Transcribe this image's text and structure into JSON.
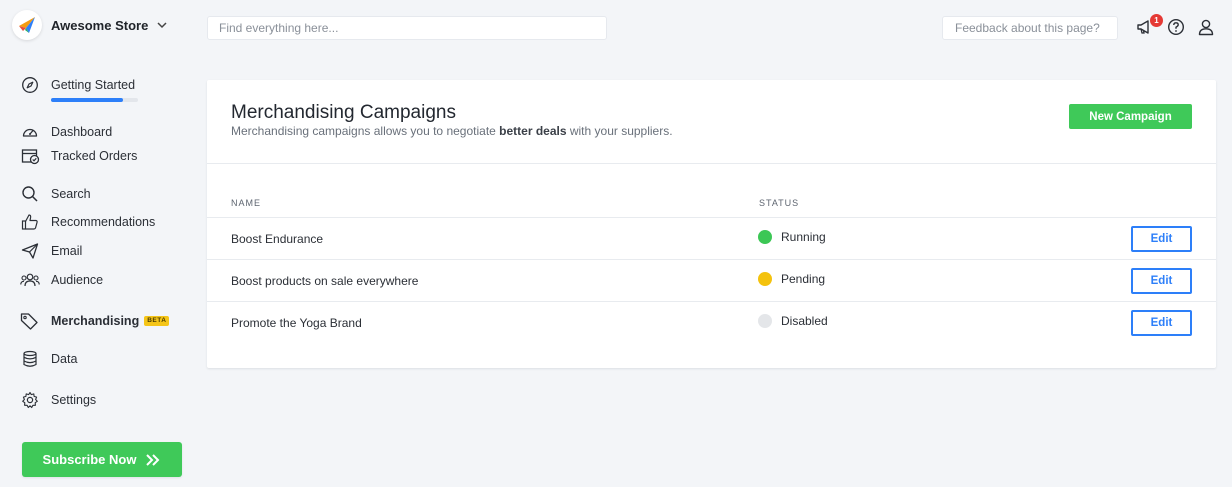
{
  "header": {
    "store_name": "Awesome Store",
    "search_placeholder": "Find everything here...",
    "feedback_placeholder": "Feedback about this page?",
    "notification_count": "1"
  },
  "sidebar": {
    "items": [
      {
        "label": "Getting Started",
        "icon": "compass-icon"
      },
      {
        "label": "Dashboard",
        "icon": "gauge-icon"
      },
      {
        "label": "Tracked Orders",
        "icon": "box-check-icon"
      },
      {
        "label": "Search",
        "icon": "search-icon"
      },
      {
        "label": "Recommendations",
        "icon": "thumbs-up-icon"
      },
      {
        "label": "Email",
        "icon": "paper-plane-icon"
      },
      {
        "label": "Audience",
        "icon": "users-icon"
      },
      {
        "label": "Merchandising",
        "icon": "tag-icon",
        "badge": "BETA",
        "active": true
      },
      {
        "label": "Data",
        "icon": "database-icon"
      },
      {
        "label": "Settings",
        "icon": "gear-icon"
      }
    ],
    "getting_started_progress": 0.83,
    "subscribe_label": "Subscribe Now"
  },
  "main": {
    "title": "Merchandising Campaigns",
    "subtitle_before": "Merchandising campaigns allows you to negotiate ",
    "subtitle_bold": "better deals",
    "subtitle_after": " with your suppliers.",
    "new_campaign_label": "New Campaign",
    "columns": [
      "NAME",
      "STATUS"
    ],
    "campaigns": [
      {
        "name": "Boost Endurance",
        "status": "Running",
        "status_color": "#3cc755",
        "action": "Edit"
      },
      {
        "name": "Boost products on sale everywhere",
        "status": "Pending",
        "status_color": "#f4c20d",
        "action": "Edit"
      },
      {
        "name": "Promote the Yoga Brand",
        "status": "Disabled",
        "status_color": "#e4e6e9",
        "action": "Edit"
      }
    ]
  },
  "colors": {
    "accent_green": "#3fc959",
    "accent_blue": "#2d7ff9",
    "background": "#f3f5f8"
  }
}
